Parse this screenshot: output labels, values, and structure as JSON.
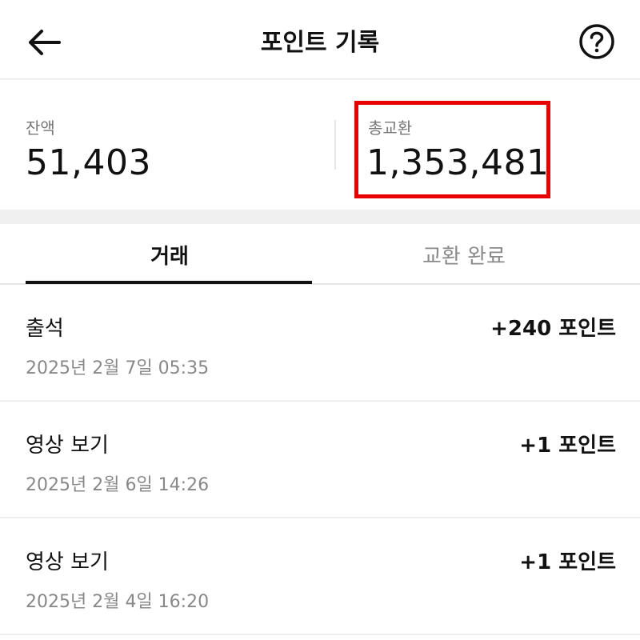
{
  "header": {
    "title": "포인트 기록",
    "back_icon": "arrow-left-icon",
    "help_icon": "question-circle-icon"
  },
  "summary": {
    "balance_label": "잔액",
    "balance_value": "51,403",
    "total_label": "총교환",
    "total_value": "1,353,481",
    "highlight_color": "#e60000"
  },
  "tabs": [
    {
      "label": "거래",
      "active": true
    },
    {
      "label": "교환 완료",
      "active": false
    }
  ],
  "transactions": [
    {
      "title": "출석",
      "date": "2025년 2월 7일 05:35",
      "points": "+240 포인트"
    },
    {
      "title": "영상 보기",
      "date": "2025년 2월 6일 14:26",
      "points": "+1 포인트"
    },
    {
      "title": "영상 보기",
      "date": "2025년 2월 4일 16:20",
      "points": "+1 포인트"
    }
  ]
}
